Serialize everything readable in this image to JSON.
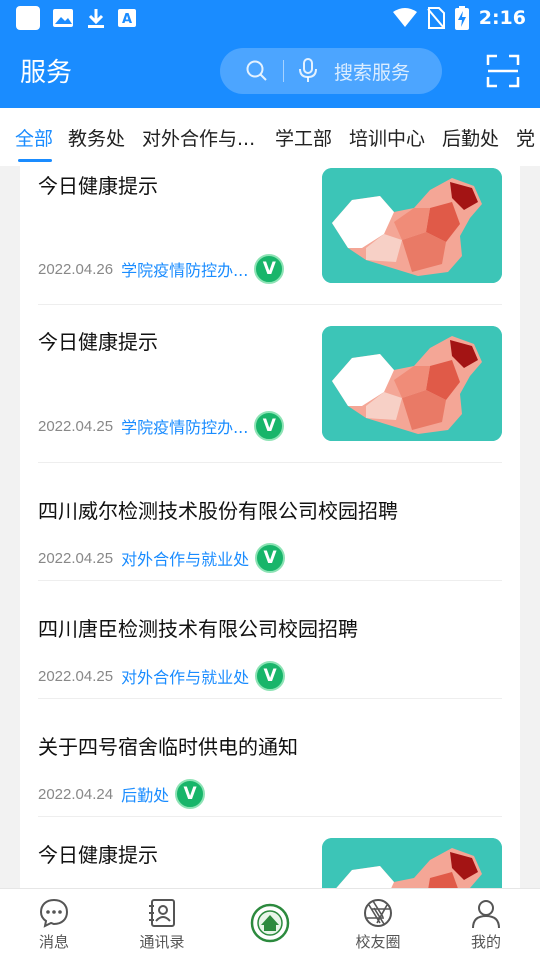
{
  "status_bar": {
    "time": "2:16"
  },
  "header": {
    "title": "服务",
    "search_placeholder": "搜索服务"
  },
  "tabs": [
    {
      "label": "全部",
      "active": true
    },
    {
      "label": "教务处",
      "active": false
    },
    {
      "label": "对外合作与...",
      "active": false
    },
    {
      "label": "学工部",
      "active": false
    },
    {
      "label": "培训中心",
      "active": false
    },
    {
      "label": "后勤处",
      "active": false
    },
    {
      "label": "党",
      "active": false
    }
  ],
  "items": [
    {
      "title": "今日健康提示",
      "date": "2022.04.26",
      "source": "学院疫情防控办...",
      "badge": "V",
      "has_image": true
    },
    {
      "title": "今日健康提示",
      "date": "2022.04.25",
      "source": "学院疫情防控办...",
      "badge": "V",
      "has_image": true
    },
    {
      "title": "四川威尔检测技术股份有限公司校园招聘",
      "date": "2022.04.25",
      "source": "对外合作与就业处",
      "badge": "V",
      "has_image": false
    },
    {
      "title": "四川唐臣检测技术有限公司校园招聘",
      "date": "2022.04.25",
      "source": "对外合作与就业处",
      "badge": "V",
      "has_image": false
    },
    {
      "title": "关于四号宿舍临时供电的通知",
      "date": "2022.04.24",
      "source": "后勤处",
      "badge": "V",
      "has_image": false
    },
    {
      "title": "今日健康提示",
      "has_image": true
    }
  ],
  "bottom_nav": [
    {
      "label": "消息",
      "icon": "chat-bubble-icon"
    },
    {
      "label": "通讯录",
      "icon": "contacts-icon"
    },
    {
      "label": "",
      "icon": "school-logo-icon"
    },
    {
      "label": "校友圈",
      "icon": "shutter-icon"
    },
    {
      "label": "我的",
      "icon": "person-icon"
    }
  ],
  "colors": {
    "primary": "#1a8cff",
    "badge_green": "#18b56a",
    "thumb_bg": "#3cc5b7"
  }
}
